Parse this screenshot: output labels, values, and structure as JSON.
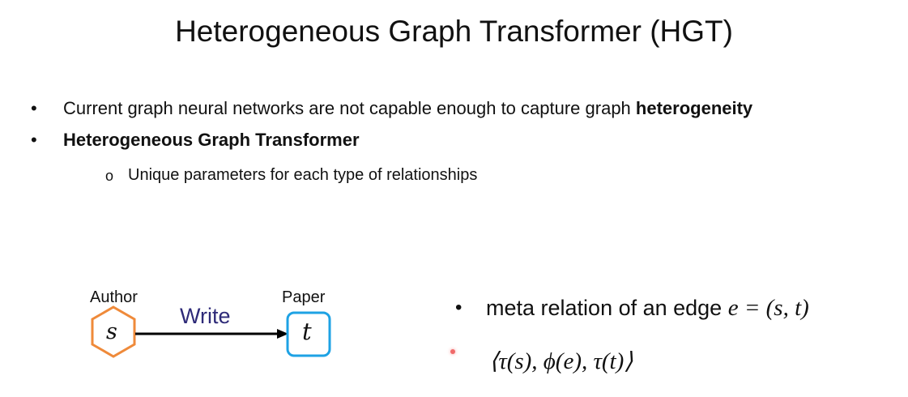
{
  "slide": {
    "title": "Heterogeneous Graph Transformer (HGT)",
    "bullets": [
      {
        "text": "Current graph neural networks are not capable enough to capture graph ",
        "bold": "heterogeneity"
      },
      {
        "bold": "Heterogeneous Graph Transformer"
      }
    ],
    "sub_bullets": [
      "Unique parameters for each type of relationships"
    ],
    "bullet_marker": "•",
    "sub_marker": "o"
  },
  "diagram": {
    "source_label": "Author",
    "source_symbol": "s",
    "target_label": "Paper",
    "target_symbol": "t",
    "edge_label": "Write",
    "colors": {
      "source": "#ef8a3a",
      "target": "#1ea2e4",
      "edge_label": "#2e2a78"
    }
  },
  "meta": {
    "text": "meta relation of an edge ",
    "equation": "e = (s, t)",
    "formula": "⟨τ(s), ϕ(e), τ(t)⟩"
  }
}
